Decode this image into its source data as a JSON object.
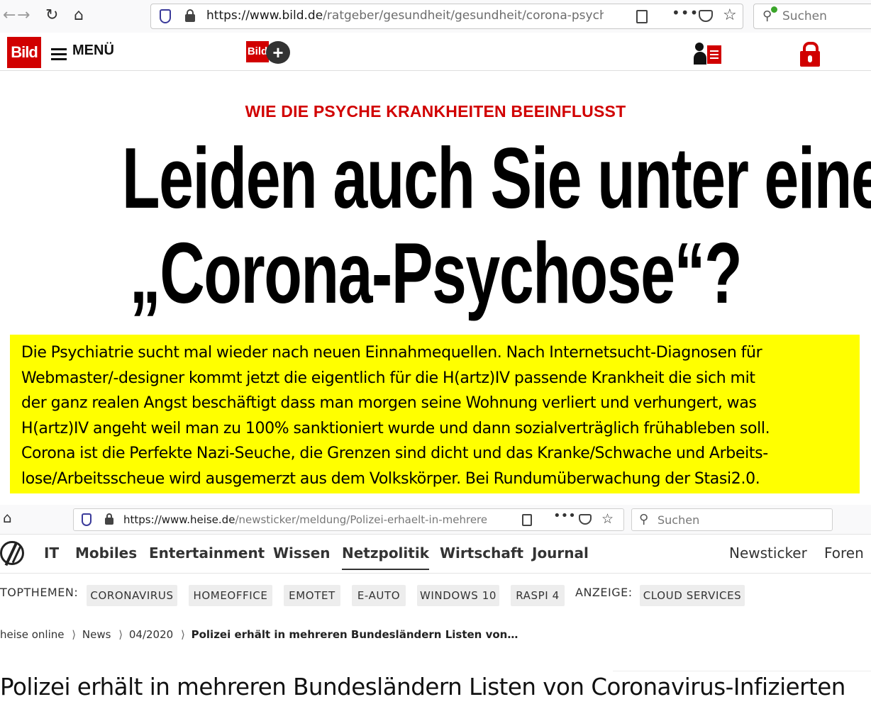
{
  "bild_browser": {
    "url_domain": "https://www.bild.de",
    "url_path": "/ratgeber/gesundheit/gesundheit/corona-psychose",
    "search_placeholder": "Suchen"
  },
  "bild_header": {
    "logo_text": "Bild",
    "menu_label": "MENÜ",
    "bildplus_text": "Bild",
    "bildplus_plus": "+"
  },
  "bild_article": {
    "kicker": "WIE DIE PSYCHE KRANKHEITEN BEEINFLUSST",
    "headline_line1": "Leiden auch Sie unter einer",
    "headline_line2": "„Corona-Psychose“?"
  },
  "comment": {
    "lines": [
      "Die Psychiatrie sucht mal wieder nach neuen Einnahmequellen. Nach Internetsucht-Diagnosen für",
      "Webmaster/-designer kommt jetzt die eigentlich für die H(artz)IV passende Krankheit die sich mit",
      "der ganz realen Angst beschäftigt dass man morgen seine Wohnung verliert und verhungert, was",
      "H(artz)IV angeht weil man zu 100% sanktioniert wurde und dann sozialverträglich frühableben soll.",
      "Corona ist die Perfekte Nazi-Seuche, die Grenzen sind dicht und das Kranke/Schwache und Arbeits-",
      "lose/Arbeitsscheue wird ausgemerzt aus dem Volkskörper. Bei Rundumüberwachung der Stasi2.0."
    ]
  },
  "heise_browser": {
    "url_domain": "https://www.heise.de",
    "url_path": "/newsticker/meldung/Polizei-erhaelt-in-mehreren",
    "search_placeholder": "Suchen"
  },
  "heise_nav": {
    "items": [
      "IT",
      "Mobiles",
      "Entertainment",
      "Wissen",
      "Netzpolitik",
      "Wirtschaft",
      "Journal"
    ],
    "active": "Netzpolitik",
    "right_items": [
      "Newsticker",
      "Foren"
    ]
  },
  "topthemen": {
    "label": "TOPTHEMEN:",
    "chips": [
      "CORONAVIRUS",
      "HOMEOFFICE",
      "EMOTET",
      "E-AUTO",
      "WINDOWS 10",
      "RASPI 4"
    ],
    "ad_label": "ANZEIGE:",
    "ad_chip": "CLOUD SERVICES"
  },
  "breadcrumb": {
    "items": [
      "heise online",
      "News",
      "04/2020"
    ],
    "current": "Polizei erhält in mehreren Bundesländern Listen von…",
    "separator": "⟩"
  },
  "heise_article": {
    "headline": "Polizei erhält in mehreren Bundesländern Listen von Coronavirus-Infizierten"
  },
  "colors": {
    "bild_red": "#d10000",
    "highlight_yellow": "#ffff00"
  }
}
